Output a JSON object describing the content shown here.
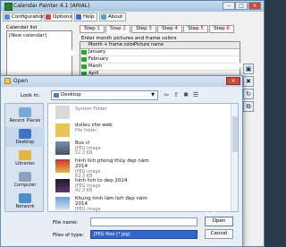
{
  "app": {
    "title": "Calendar Painter 4.1 (ARIAL)",
    "toolbar": [
      "Configuration",
      "Options",
      "Help",
      "About"
    ],
    "side_label": "Calendar list",
    "side_list": [
      "[New calendar]"
    ],
    "steps": [
      {
        "label": "Step",
        "num": "1"
      },
      {
        "label": "Step",
        "num": "2"
      },
      {
        "label": "Step",
        "num": "3"
      },
      {
        "label": "Step",
        "num": "4"
      },
      {
        "label": "Step",
        "num": "5"
      },
      {
        "label": "Step",
        "num": "6"
      }
    ],
    "instruction": "Enter month pictures and frame colors",
    "grid_headers": [
      "Month + frame color",
      "Picture name"
    ],
    "months": [
      "January",
      "February",
      "March",
      "April"
    ]
  },
  "dialog": {
    "title": "Open",
    "look_in_label": "Look in:",
    "look_in_value": "Desktop",
    "places": [
      "Recent Places",
      "Desktop",
      "Libraries",
      "Computer",
      "Network"
    ],
    "files": [
      {
        "name": "",
        "type": "System Folder",
        "size": ""
      },
      {
        "name": "dulieu cho web",
        "type": "File folder",
        "size": ""
      },
      {
        "name": "Bus cl",
        "type": "JPEG image",
        "size": "52,3 KB"
      },
      {
        "name": "hinh lich phong thủy đẹp năm 2014",
        "type": "JPEG image",
        "size": "62,3 KB"
      },
      {
        "name": "hinh lich to dep 2014",
        "type": "JPEG image",
        "size": "42,3 KB"
      },
      {
        "name": "Khung hình làm lịch đẹp năm 2014",
        "type": "JPEG image",
        "size": ""
      }
    ],
    "file_name_label": "File name:",
    "file_name_value": "",
    "file_type_label": "Files of type:",
    "file_type_value": "JPEG files (*.jpg)",
    "open_label": "Open",
    "cancel_label": "Cancel"
  }
}
